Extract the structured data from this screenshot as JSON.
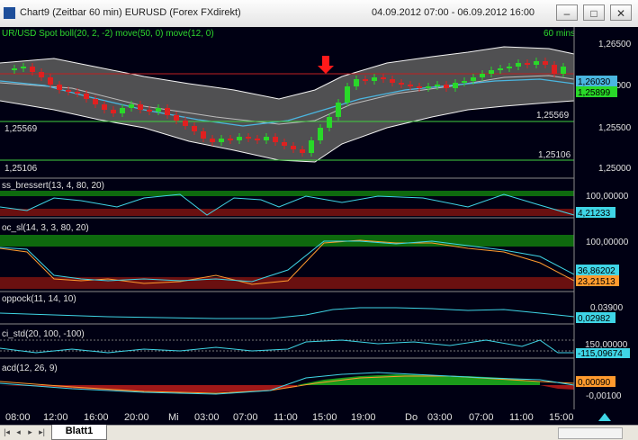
{
  "window": {
    "title": "Chart9 (Zeitbar 60 min)  EURUSD  (Forex FXdirekt)",
    "date_range": "04.09.2012 07:00 - 06.09.2012 16:00",
    "min_label": "–",
    "max_label": "□",
    "close_label": "✕"
  },
  "panels": {
    "price": {
      "label": "UR/USD Spot  boll(20, 2, -2) move(50, 0) move(12, 0)",
      "timeframe": "60 mins",
      "axis_ticks": [
        "1,26500",
        "1,26000",
        "1,25500",
        "1,25000"
      ],
      "badges": [
        "1,26030",
        "1,25899",
        "1,25569"
      ],
      "levels": [
        "1,25569",
        "1,25106",
        "1,25569",
        "1,25106"
      ]
    },
    "indicator1": {
      "label": "ss_bressert(13, 4, 80, 20)",
      "axis_ticks": [
        "100,00000",
        "0,00000"
      ],
      "badges": [
        "4,21233"
      ]
    },
    "indicator2": {
      "label": "oc_sl(14, 3, 3, 80, 20)",
      "axis_ticks": [
        "100,00000"
      ],
      "badges": [
        "36,86202",
        "23,21513"
      ]
    },
    "indicator3": {
      "label": "oppock(11, 14, 10)",
      "axis_ticks": [
        "0,03900"
      ],
      "badges": [
        "0,02982"
      ]
    },
    "indicator4": {
      "label": "ci_std(20, 100, -100)",
      "axis_ticks": [
        "150,00000"
      ],
      "badges": [
        "-115,09674"
      ]
    },
    "indicator5": {
      "label": "acd(12, 26, 9)",
      "axis_ticks": [
        "-0,00100"
      ],
      "badges": [
        "0,00090"
      ]
    }
  },
  "time_axis": [
    "08:00",
    "12:00",
    "16:00",
    "20:00",
    "Mi",
    "03:00",
    "07:00",
    "11:00",
    "15:00",
    "19:00",
    "Do",
    "03:00",
    "07:00",
    "11:00",
    "15:00"
  ],
  "sheet_tab": "Blatt1",
  "colors": {
    "background": "#000013",
    "band_fill": "#5e5e5e",
    "bull": "#29d829",
    "bear": "#e02020",
    "resistance": "#c02020",
    "support": "#3fcf3f",
    "signal_arrow": "#ff1a1a"
  }
}
